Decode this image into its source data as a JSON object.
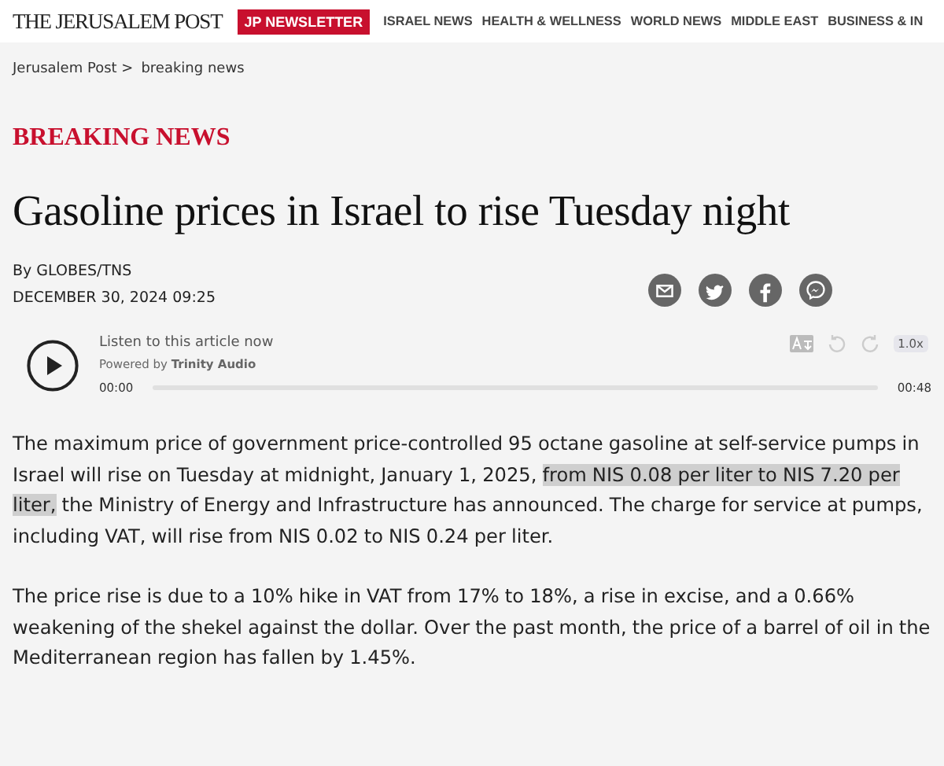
{
  "header": {
    "logo": "THE JERUSALEM POST",
    "newsletter": "JP NEWSLETTER",
    "nav": [
      "ISRAEL NEWS",
      "HEALTH & WELLNESS",
      "WORLD NEWS",
      "MIDDLE EAST",
      "BUSINESS & IN"
    ]
  },
  "breadcrumb": [
    "Jerusalem Post >",
    "breaking news"
  ],
  "section": "BREAKING NEWS",
  "headline": "Gasoline prices in Israel to rise Tuesday night",
  "byline": "By GLOBES/TNS",
  "date": "DECEMBER 30, 2024 09:25",
  "share": [
    {
      "kind": "email"
    },
    {
      "kind": "twitter"
    },
    {
      "kind": "facebook"
    },
    {
      "kind": "messenger"
    }
  ],
  "audio": {
    "title": "Listen to this article now",
    "powered_by": "Powered by",
    "provider": "Trinity Audio",
    "current_time": "00:00",
    "duration": "00:48",
    "level": 0,
    "speed": "1.0x"
  },
  "paragraphs": [
    [
      {
        "text": "The maximum price of government price-controlled 95 octane gasoline at self-service pumps in Israel will rise on Tuesday at midnight, January 1, 2025, ",
        "highlighted": false
      },
      {
        "text": "from NIS 0.08 per liter to NIS 7.20 per liter,",
        "highlighted": true
      },
      {
        "text": " the Ministry of Energy and Infrastructure has announced. The charge for service at pumps, including VAT, will rise from NIS 0.02 to NIS 0.24 per liter.",
        "highlighted": false
      }
    ],
    [
      {
        "text": "The price rise is due to a 10% hike in VAT from 17% to 18%, a rise in excise, and a 0.66% weakening of the shekel against the dollar. Over the past month, the price of a barrel of oil in the Mediterranean region has fallen by 1.45%.",
        "highlighted": false
      }
    ]
  ]
}
